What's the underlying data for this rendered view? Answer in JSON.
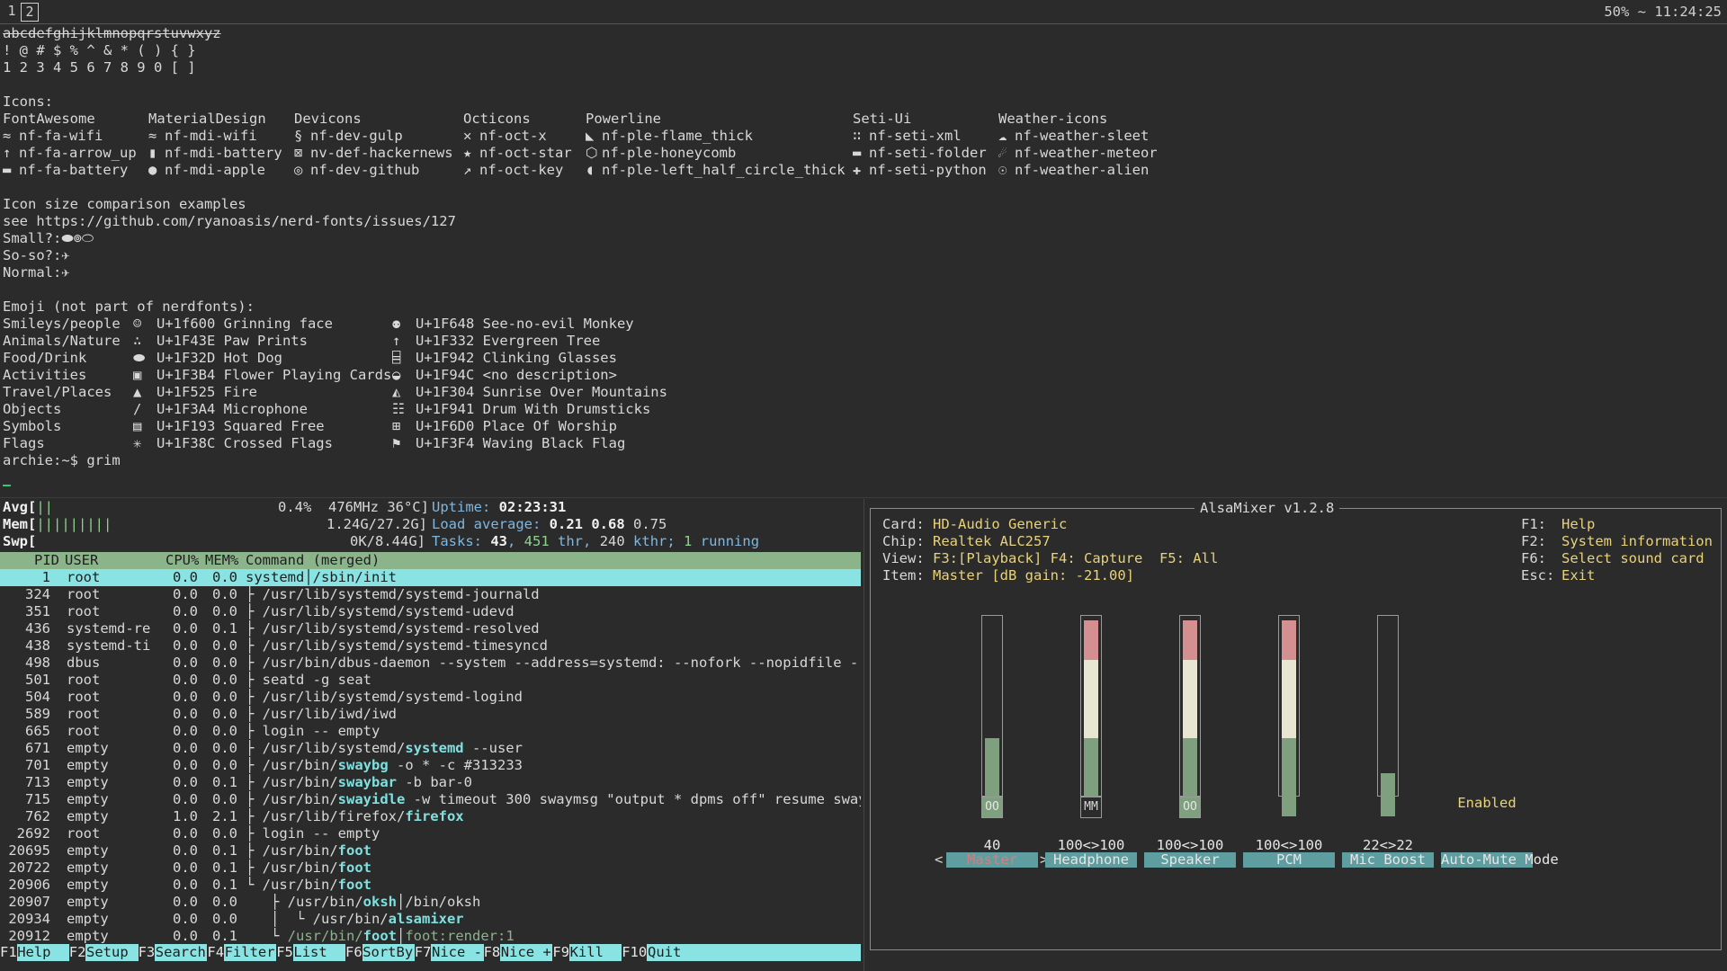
{
  "topbar": {
    "workspace_1": "1",
    "workspace_2": "2",
    "status": "50% ~ 11:24:25"
  },
  "terminal": {
    "lines": {
      "alpha": "abcdefghijklmnopqrstuvwxyz",
      "symbols": "! @ # $ % ^ & * ( ) { }",
      "digits": "1 2 3 4 5 6 7 8 9 0 [ ]",
      "icons_header": "Icons:"
    },
    "icon_columns": [
      {
        "title": "FontAwesome",
        "items": [
          {
            "glyph": "≈",
            "label": "nf-fa-wifi"
          },
          {
            "glyph": "↑",
            "label": "nf-fa-arrow_up"
          },
          {
            "glyph": "▬",
            "label": "nf-fa-battery"
          }
        ]
      },
      {
        "title": "MaterialDesign",
        "items": [
          {
            "glyph": "≈",
            "label": "nf-mdi-wifi"
          },
          {
            "glyph": "▮",
            "label": "nf-mdi-battery"
          },
          {
            "glyph": "●",
            "label": "nf-mdi-apple"
          }
        ]
      },
      {
        "title": "Devicons",
        "items": [
          {
            "glyph": "§",
            "label": "nf-dev-gulp"
          },
          {
            "glyph": "⊠",
            "label": "nv-def-hackernews"
          },
          {
            "glyph": "◎",
            "label": "nf-dev-github"
          }
        ]
      },
      {
        "title": "Octicons",
        "items": [
          {
            "glyph": "✕",
            "label": "nf-oct-x"
          },
          {
            "glyph": "★",
            "label": "nf-oct-star"
          },
          {
            "glyph": "↗",
            "label": "nf-oct-key"
          }
        ]
      },
      {
        "title": "Powerline",
        "items": [
          {
            "glyph": "◣",
            "label": "nf-ple-flame_thick"
          },
          {
            "glyph": "⬡",
            "label": "nf-ple-honeycomb"
          },
          {
            "glyph": "◖",
            "label": "nf-ple-left_half_circle_thick"
          }
        ]
      },
      {
        "title": "Seti-Ui",
        "items": [
          {
            "glyph": "∷",
            "label": "nf-seti-xml"
          },
          {
            "glyph": "▬",
            "label": "nf-seti-folder"
          },
          {
            "glyph": "✚",
            "label": "nf-seti-python"
          }
        ]
      },
      {
        "title": "Weather-icons",
        "items": [
          {
            "glyph": "☁",
            "label": "nf-weather-sleet"
          },
          {
            "glyph": "☄",
            "label": "nf-weather-meteor"
          },
          {
            "glyph": "☉",
            "label": "nf-weather-alien"
          }
        ]
      }
    ],
    "size_section": {
      "title": "Icon size comparison examples",
      "link": "see https://github.com/ryanoasis/nerd-fonts/issues/127",
      "small": "Small?:",
      "small_glyphs": "⬬⊚⬭",
      "soso": "So-so?:",
      "soso_glyphs": "✈",
      "normal": "Normal:",
      "normal_glyphs": "✈"
    },
    "emoji_title": "Emoji (not part of nerdfonts):",
    "emoji_rows": [
      {
        "cat": "Smileys/people",
        "g1": "☺",
        "c1": "U+1f600 Grinning face",
        "g2": "⚉",
        "c2": "U+1F648 See-no-evil Monkey"
      },
      {
        "cat": "Animals/Nature",
        "g1": "∴",
        "c1": "U+1F43E Paw Prints",
        "g2": "↑",
        "c2": "U+1F332 Evergreen Tree"
      },
      {
        "cat": "Food/Drink",
        "g1": "⬬",
        "c1": "U+1F32D Hot Dog",
        "g2": "⌸",
        "c2": "U+1F942 Clinking Glasses"
      },
      {
        "cat": "Activities",
        "g1": "▣",
        "c1": "U+1F3B4 Flower Playing Cards",
        "g2": "◒",
        "c2": "U+1F94C <no description>"
      },
      {
        "cat": "Travel/Places",
        "g1": "▲",
        "c1": "U+1F525 Fire",
        "g2": "◭",
        "c2": "U+1F304 Sunrise Over Mountains"
      },
      {
        "cat": "Objects",
        "g1": "/",
        "c1": "U+1F3A4 Microphone",
        "g2": "☷",
        "c2": "U+1F941 Drum With Drumsticks"
      },
      {
        "cat": "Symbols",
        "g1": "▤",
        "c1": "U+1F193 Squared Free",
        "g2": "⊞",
        "c2": "U+1F6D0 Place Of Worship"
      },
      {
        "cat": "Flags",
        "g1": "✳",
        "c1": "U+1F38C Crossed Flags",
        "g2": "⚑",
        "c2": "U+1F3F4 Waving Black Flag"
      }
    ],
    "prompt": "archie:~$ grim"
  },
  "htop": {
    "avg_label": "Avg[",
    "avg_bars": "||",
    "avg_value": "0.4%  476MHz 36°C]",
    "mem_label": "Mem[",
    "mem_bars": "|||||||||",
    "mem_value": "1.24G/27.2G]",
    "swp_label": "Swp[",
    "swp_value": "0K/8.44G]",
    "uptime_label": "Uptime: ",
    "uptime_value": "02:23:31",
    "load_label": "Load average: ",
    "load_1": "0.21",
    "load_5": "0.68",
    "load_15": "0.75",
    "tasks_label": "Tasks: ",
    "tasks_count": "43",
    "tasks_thr": "451",
    "tasks_thr_label": "thr,",
    "tasks_kthr": "240",
    "tasks_kthr_label": "kthr;",
    "tasks_run": "1",
    "tasks_run_label": "running",
    "columns": {
      "pid": "PID",
      "user": "USER",
      "cpu": "CPU%",
      "mem": "MEM%",
      "command": "Command (merged)"
    },
    "processes": [
      {
        "pid": "1",
        "user": "root",
        "cpu": "0.0",
        "mem": "0.0",
        "tree": "",
        "cmd": "systemd",
        "rest": "/sbin/init"
      },
      {
        "pid": "324",
        "user": "root",
        "cpu": "0.0",
        "mem": "0.0",
        "tree": "├ ",
        "cmd": "/usr/lib/systemd/systemd-journald",
        "rest": ""
      },
      {
        "pid": "351",
        "user": "root",
        "cpu": "0.0",
        "mem": "0.0",
        "tree": "├ ",
        "cmd": "/usr/lib/systemd/systemd-udevd",
        "rest": ""
      },
      {
        "pid": "436",
        "user": "systemd-re",
        "cpu": "0.0",
        "mem": "0.1",
        "tree": "├ ",
        "cmd": "/usr/lib/systemd/systemd-resolved",
        "rest": ""
      },
      {
        "pid": "438",
        "user": "systemd-ti",
        "cpu": "0.0",
        "mem": "0.0",
        "tree": "├ ",
        "cmd": "/usr/lib/systemd/systemd-timesyncd",
        "rest": ""
      },
      {
        "pid": "498",
        "user": "dbus",
        "cpu": "0.0",
        "mem": "0.0",
        "tree": "├ ",
        "cmd": "/usr/bin/dbus-daemon --system --address=systemd: --nofork --nopidfile --s",
        "rest": ""
      },
      {
        "pid": "501",
        "user": "root",
        "cpu": "0.0",
        "mem": "0.0",
        "tree": "├ ",
        "cmd": "seatd -g seat",
        "rest": ""
      },
      {
        "pid": "504",
        "user": "root",
        "cpu": "0.0",
        "mem": "0.0",
        "tree": "├ ",
        "cmd": "/usr/lib/systemd/systemd-logind",
        "rest": ""
      },
      {
        "pid": "589",
        "user": "root",
        "cpu": "0.0",
        "mem": "0.0",
        "tree": "├ ",
        "cmd": "/usr/lib/iwd/iwd",
        "rest": ""
      },
      {
        "pid": "665",
        "user": "root",
        "cpu": "0.0",
        "mem": "0.0",
        "tree": "├ ",
        "cmd": "login -- empty",
        "rest": ""
      },
      {
        "pid": "671",
        "user": "empty",
        "cpu": "0.0",
        "mem": "0.0",
        "tree": "├ ",
        "cmd": "/usr/lib/systemd/systemd --user",
        "rest": ""
      },
      {
        "pid": "701",
        "user": "empty",
        "cpu": "0.0",
        "mem": "0.0",
        "tree": "├ ",
        "cmd": "/usr/bin/swaybg -o * -c #313233",
        "rest": ""
      },
      {
        "pid": "713",
        "user": "empty",
        "cpu": "0.0",
        "mem": "0.1",
        "tree": "├ ",
        "cmd": "/usr/bin/swaybar -b bar-0",
        "rest": ""
      },
      {
        "pid": "715",
        "user": "empty",
        "cpu": "0.0",
        "mem": "0.0",
        "tree": "├ ",
        "cmd": "/usr/bin/swayidle -w timeout 300 swaymsg \"output * dpms off\" resume swaym",
        "rest": ""
      },
      {
        "pid": "762",
        "user": "empty",
        "cpu": "1.0",
        "mem": "2.1",
        "tree": "├ ",
        "cmd": "/usr/lib/firefox/firefox",
        "rest": ""
      },
      {
        "pid": "2692",
        "user": "root",
        "cpu": "0.0",
        "mem": "0.0",
        "tree": "├ ",
        "cmd": "login -- empty",
        "rest": ""
      },
      {
        "pid": "20695",
        "user": "empty",
        "cpu": "0.0",
        "mem": "0.1",
        "tree": "├ ",
        "cmd": "/usr/bin/foot",
        "rest": ""
      },
      {
        "pid": "20722",
        "user": "empty",
        "cpu": "0.0",
        "mem": "0.1",
        "tree": "├ ",
        "cmd": "/usr/bin/foot",
        "rest": ""
      },
      {
        "pid": "20906",
        "user": "empty",
        "cpu": "0.0",
        "mem": "0.1",
        "tree": "└ ",
        "cmd": "/usr/bin/foot",
        "rest": ""
      },
      {
        "pid": "20907",
        "user": "empty",
        "cpu": "0.0",
        "mem": "0.0",
        "tree": "   ├ ",
        "cmd": "/usr/bin/oksh",
        "rest": "/bin/oksh"
      },
      {
        "pid": "20934",
        "user": "empty",
        "cpu": "0.0",
        "mem": "0.0",
        "tree": "   │  └ ",
        "cmd": "/usr/bin/alsamixer",
        "rest": ""
      },
      {
        "pid": "20912",
        "user": "empty",
        "cpu": "0.0",
        "mem": "0.1",
        "tree": "   └ ",
        "cmd": "/usr/bin/foot",
        "rest": "foot:render:1"
      }
    ],
    "footer": [
      {
        "key": "F1",
        "label": "Help"
      },
      {
        "key": "F2",
        "label": "Setup"
      },
      {
        "key": "F3",
        "label": "Search"
      },
      {
        "key": "F4",
        "label": "Filter"
      },
      {
        "key": "F5",
        "label": "List"
      },
      {
        "key": "F6",
        "label": "SortBy"
      },
      {
        "key": "F7",
        "label": "Nice -"
      },
      {
        "key": "F8",
        "label": "Nice +"
      },
      {
        "key": "F9",
        "label": "Kill"
      },
      {
        "key": "F10",
        "label": "Quit"
      }
    ]
  },
  "alsamixer": {
    "title": "AlsaMixer v1.2.8",
    "card_label": "Card:",
    "card": "HD-Audio Generic",
    "chip_label": "Chip:",
    "chip": "Realtek ALC257",
    "view_label": "View:",
    "view": "F3:[Playback] F4: Capture  F5: All",
    "item_label": "Item:",
    "item": "Master [dB gain: -21.00]",
    "help": [
      {
        "key": "F1:",
        "label": "Help"
      },
      {
        "key": "F2:",
        "label": "System information"
      },
      {
        "key": "F6:",
        "label": "Select sound card"
      },
      {
        "key": "Esc:",
        "label": "Exit"
      }
    ],
    "channels": [
      {
        "name": "Master",
        "value": "40",
        "level": 0.4,
        "mute": "OO",
        "selected": true
      },
      {
        "name": "Headphone",
        "value": "100<>100",
        "level": 1.0,
        "mute": "MM",
        "selected": false
      },
      {
        "name": "Speaker",
        "value": "100<>100",
        "level": 1.0,
        "mute": "OO",
        "selected": false
      },
      {
        "name": "PCM",
        "value": "100<>100",
        "level": 1.0,
        "mute": "",
        "selected": false
      },
      {
        "name": "Mic Boost",
        "value": "22<>22",
        "level": 0.22,
        "mute": "",
        "selected": false
      },
      {
        "name": "Auto-Mute Mode",
        "value": "",
        "level": null,
        "mute": "",
        "selected": false,
        "state": "Enabled"
      }
    ],
    "left_arrow": "<",
    "right_arrow": ">"
  }
}
